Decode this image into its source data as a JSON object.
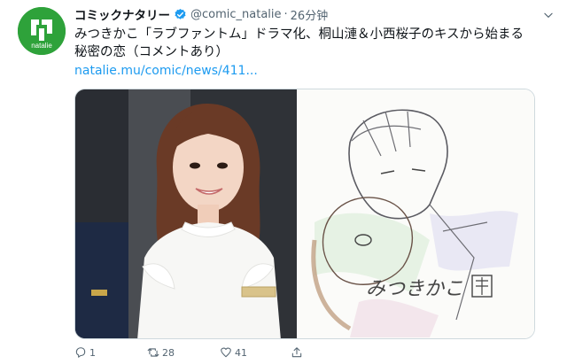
{
  "account": {
    "name": "コミックナタリー",
    "handle": "@comic_natalie",
    "separator": "·",
    "time": "26分钟",
    "avatar_label": "natalie"
  },
  "tweet": {
    "text": "みつきかこ「ラブファントム」ドラマ化、桐山漣＆小西桜子のキスから始まる秘密の恋（コメントあり）",
    "link": "natalie.mu/comic/news/411..."
  },
  "media": {
    "signature": "みつきかこ"
  },
  "actions": {
    "replies": "1",
    "retweets": "28",
    "likes": "41"
  },
  "colors": {
    "brand_green": "#2ea23a",
    "verified_blue": "#1d9bf0",
    "link_blue": "#1d9bf0",
    "meta_gray": "#536471"
  },
  "icons": {
    "verified": "verified-badge-icon",
    "more": "chevron-down-icon",
    "reply": "reply-icon",
    "retweet": "retweet-icon",
    "like": "heart-icon",
    "share": "share-icon"
  }
}
